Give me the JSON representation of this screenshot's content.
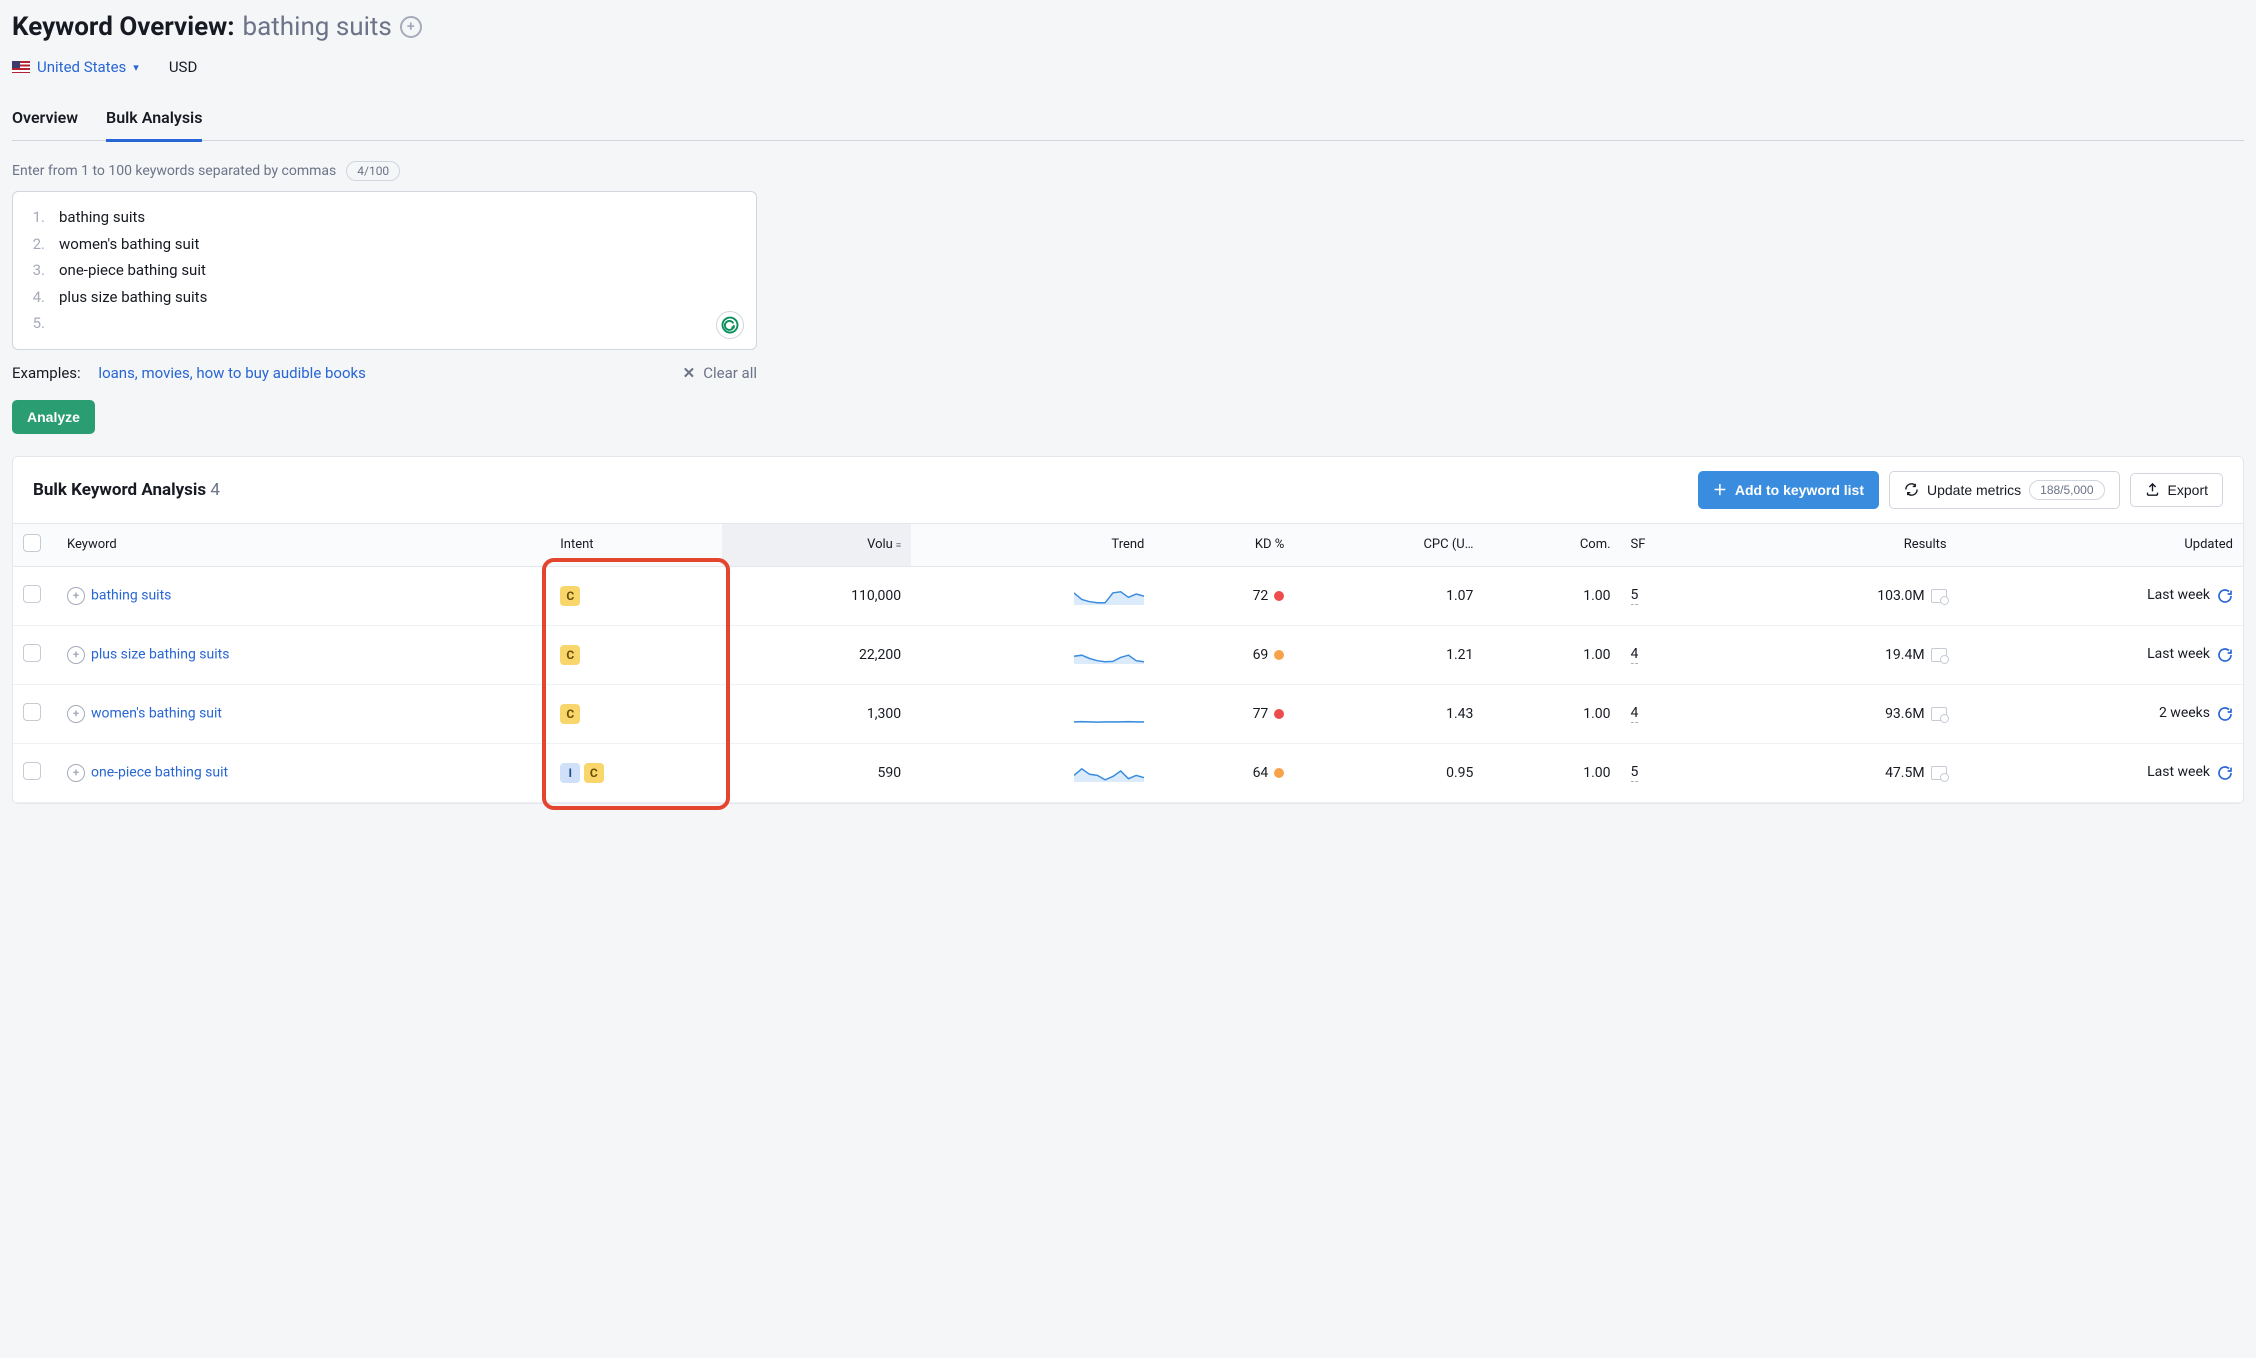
{
  "header": {
    "title_prefix": "Keyword Overview:",
    "keyword": "bathing suits",
    "country": "United States",
    "currency": "USD"
  },
  "tabs": [
    {
      "label": "Overview",
      "active": false
    },
    {
      "label": "Bulk Analysis",
      "active": true
    }
  ],
  "bulk_input": {
    "instructions": "Enter from 1 to 100 keywords separated by commas",
    "counter": "4/100",
    "lines": [
      "bathing suits",
      "women's bathing suit",
      "one-piece bathing suit",
      "plus size bathing suits"
    ],
    "examples_label": "Examples:",
    "examples_link": "loans, movies, how to buy audible books",
    "clear_all": "Clear all",
    "analyze": "Analyze"
  },
  "panel": {
    "title": "Bulk Keyword Analysis",
    "count": "4",
    "add_to_list": "Add to keyword list",
    "update_metrics": "Update metrics",
    "update_counter": "188/5,000",
    "export": "Export"
  },
  "columns": {
    "keyword": "Keyword",
    "intent": "Intent",
    "volume": "Volu",
    "trend": "Trend",
    "kd": "KD %",
    "cpc": "CPC (U…",
    "com": "Com.",
    "sf": "SF",
    "results": "Results",
    "updated": "Updated"
  },
  "rows": [
    {
      "keyword": "bathing suits",
      "intents": [
        "C"
      ],
      "volume": "110,000",
      "trend": [
        0.55,
        0.25,
        0.15,
        0.1,
        0.1,
        0.55,
        0.6,
        0.35,
        0.5,
        0.4
      ],
      "kd": "72",
      "kd_dot": "red",
      "cpc": "1.07",
      "com": "1.00",
      "sf": "5",
      "results": "103.0M",
      "updated": "Last week"
    },
    {
      "keyword": "plus size bathing suits",
      "intents": [
        "C"
      ],
      "volume": "22,200",
      "trend": [
        0.35,
        0.4,
        0.25,
        0.15,
        0.1,
        0.12,
        0.3,
        0.4,
        0.15,
        0.1
      ],
      "kd": "69",
      "kd_dot": "orange",
      "cpc": "1.21",
      "com": "1.00",
      "sf": "4",
      "results": "19.4M",
      "updated": "Last week"
    },
    {
      "keyword": "women's bathing suit",
      "intents": [
        "C"
      ],
      "volume": "1,300",
      "trend": [
        0.05,
        0.06,
        0.05,
        0.04,
        0.05,
        0.05,
        0.05,
        0.06,
        0.05,
        0.05
      ],
      "kd": "77",
      "kd_dot": "red",
      "cpc": "1.43",
      "com": "1.00",
      "sf": "4",
      "results": "93.6M",
      "updated": "2 weeks"
    },
    {
      "keyword": "one-piece bathing suit",
      "intents": [
        "I",
        "C"
      ],
      "volume": "590",
      "trend": [
        0.3,
        0.6,
        0.35,
        0.3,
        0.1,
        0.25,
        0.5,
        0.15,
        0.3,
        0.2
      ],
      "kd": "64",
      "kd_dot": "orange",
      "cpc": "0.95",
      "com": "1.00",
      "sf": "5",
      "results": "47.5M",
      "updated": "Last week"
    }
  ]
}
